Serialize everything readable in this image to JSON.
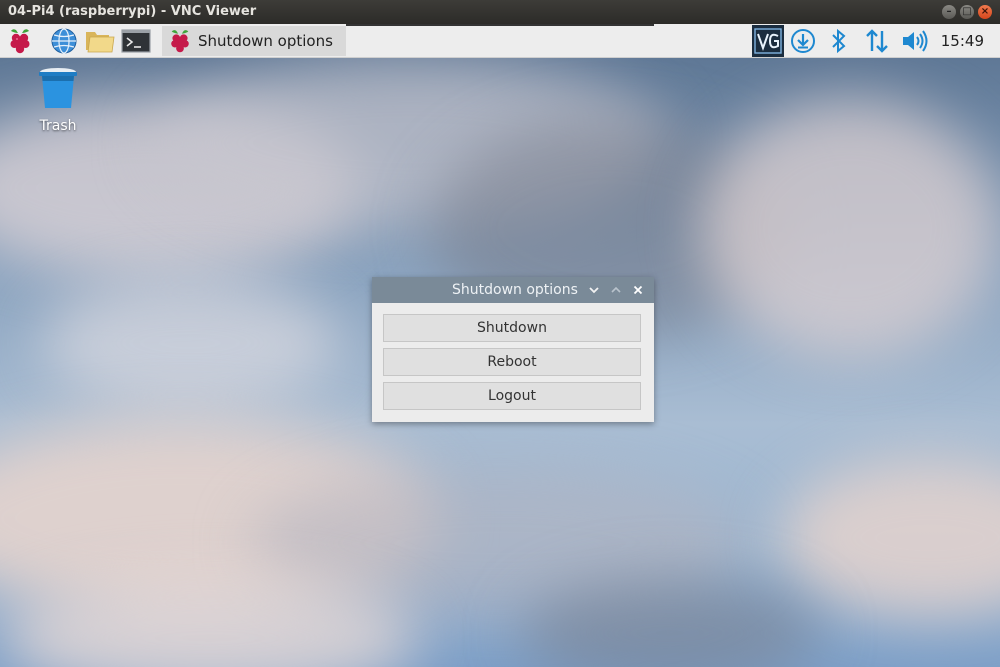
{
  "window": {
    "title": "04-Pi4 (raspberrypi) - VNC Viewer"
  },
  "taskbar": {
    "launchers": [
      {
        "icon": "raspberry-menu-icon"
      },
      {
        "icon": "web-browser-icon"
      },
      {
        "icon": "file-manager-icon"
      },
      {
        "icon": "terminal-icon"
      }
    ],
    "active_task": {
      "icon": "raspberry-icon",
      "label": "Shutdown options"
    },
    "tray": {
      "vnc_icon": "vnc-server-icon",
      "updates_icon": "download-updates-icon",
      "bluetooth_icon": "bluetooth-icon",
      "network_icon": "network-arrows-icon",
      "volume_icon": "volume-icon",
      "clock": "15:49"
    }
  },
  "desktop": {
    "trash_label": "Trash"
  },
  "dialog": {
    "title": "Shutdown options",
    "buttons": {
      "shutdown": "Shutdown",
      "reboot": "Reboot",
      "logout": "Logout"
    },
    "controls": {
      "minimize": "⌄",
      "maximize": "⌃",
      "close": "✕"
    }
  },
  "colors": {
    "dialog_titlebar": "#7a8a98",
    "taskbar": "#ededed",
    "accent_blue": "#1e88d0"
  }
}
